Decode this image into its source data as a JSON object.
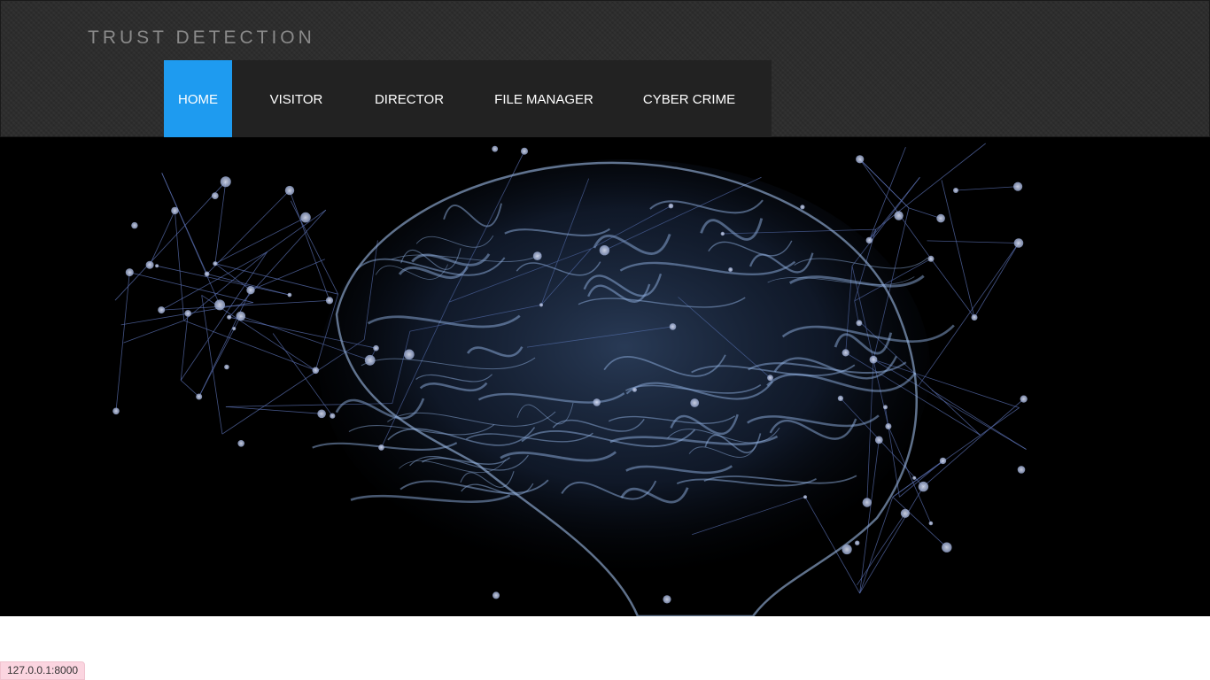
{
  "site": {
    "title": "TRUST DETECTION"
  },
  "nav": {
    "items": [
      {
        "label": "HOME",
        "active": true
      },
      {
        "label": "VISITOR",
        "active": false
      },
      {
        "label": "DIRECTOR",
        "active": false
      },
      {
        "label": "FILE MANAGER",
        "active": false
      },
      {
        "label": "CYBER CRIME",
        "active": false
      }
    ],
    "active_color": "#1e9bf0"
  },
  "hero": {
    "image": "brain-network-image"
  },
  "status_bar": {
    "url": "127.0.0.1:8000"
  }
}
